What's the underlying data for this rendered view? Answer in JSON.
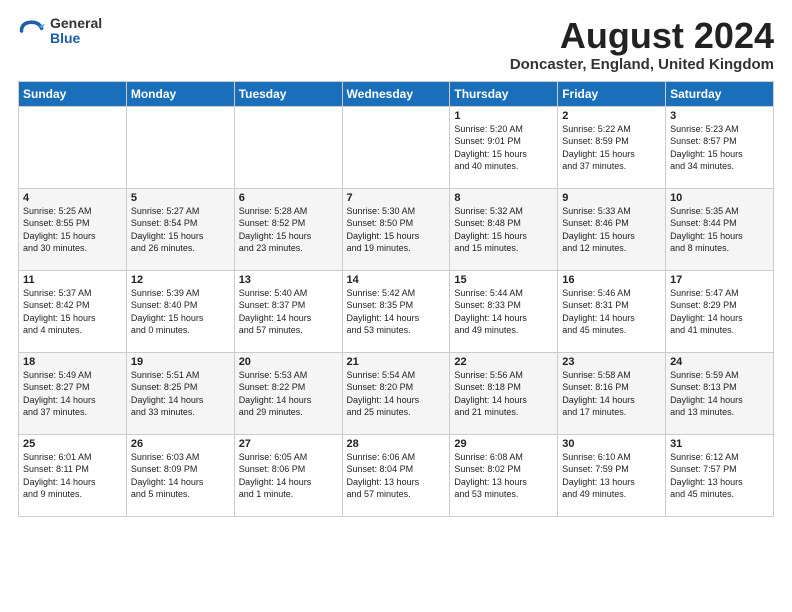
{
  "header": {
    "logo_general": "General",
    "logo_blue": "Blue",
    "month_title": "August 2024",
    "location": "Doncaster, England, United Kingdom"
  },
  "days_of_week": [
    "Sunday",
    "Monday",
    "Tuesday",
    "Wednesday",
    "Thursday",
    "Friday",
    "Saturday"
  ],
  "weeks": [
    [
      {
        "day": "",
        "info": ""
      },
      {
        "day": "",
        "info": ""
      },
      {
        "day": "",
        "info": ""
      },
      {
        "day": "",
        "info": ""
      },
      {
        "day": "1",
        "info": "Sunrise: 5:20 AM\nSunset: 9:01 PM\nDaylight: 15 hours\nand 40 minutes."
      },
      {
        "day": "2",
        "info": "Sunrise: 5:22 AM\nSunset: 8:59 PM\nDaylight: 15 hours\nand 37 minutes."
      },
      {
        "day": "3",
        "info": "Sunrise: 5:23 AM\nSunset: 8:57 PM\nDaylight: 15 hours\nand 34 minutes."
      }
    ],
    [
      {
        "day": "4",
        "info": "Sunrise: 5:25 AM\nSunset: 8:55 PM\nDaylight: 15 hours\nand 30 minutes."
      },
      {
        "day": "5",
        "info": "Sunrise: 5:27 AM\nSunset: 8:54 PM\nDaylight: 15 hours\nand 26 minutes."
      },
      {
        "day": "6",
        "info": "Sunrise: 5:28 AM\nSunset: 8:52 PM\nDaylight: 15 hours\nand 23 minutes."
      },
      {
        "day": "7",
        "info": "Sunrise: 5:30 AM\nSunset: 8:50 PM\nDaylight: 15 hours\nand 19 minutes."
      },
      {
        "day": "8",
        "info": "Sunrise: 5:32 AM\nSunset: 8:48 PM\nDaylight: 15 hours\nand 15 minutes."
      },
      {
        "day": "9",
        "info": "Sunrise: 5:33 AM\nSunset: 8:46 PM\nDaylight: 15 hours\nand 12 minutes."
      },
      {
        "day": "10",
        "info": "Sunrise: 5:35 AM\nSunset: 8:44 PM\nDaylight: 15 hours\nand 8 minutes."
      }
    ],
    [
      {
        "day": "11",
        "info": "Sunrise: 5:37 AM\nSunset: 8:42 PM\nDaylight: 15 hours\nand 4 minutes."
      },
      {
        "day": "12",
        "info": "Sunrise: 5:39 AM\nSunset: 8:40 PM\nDaylight: 15 hours\nand 0 minutes."
      },
      {
        "day": "13",
        "info": "Sunrise: 5:40 AM\nSunset: 8:37 PM\nDaylight: 14 hours\nand 57 minutes."
      },
      {
        "day": "14",
        "info": "Sunrise: 5:42 AM\nSunset: 8:35 PM\nDaylight: 14 hours\nand 53 minutes."
      },
      {
        "day": "15",
        "info": "Sunrise: 5:44 AM\nSunset: 8:33 PM\nDaylight: 14 hours\nand 49 minutes."
      },
      {
        "day": "16",
        "info": "Sunrise: 5:46 AM\nSunset: 8:31 PM\nDaylight: 14 hours\nand 45 minutes."
      },
      {
        "day": "17",
        "info": "Sunrise: 5:47 AM\nSunset: 8:29 PM\nDaylight: 14 hours\nand 41 minutes."
      }
    ],
    [
      {
        "day": "18",
        "info": "Sunrise: 5:49 AM\nSunset: 8:27 PM\nDaylight: 14 hours\nand 37 minutes."
      },
      {
        "day": "19",
        "info": "Sunrise: 5:51 AM\nSunset: 8:25 PM\nDaylight: 14 hours\nand 33 minutes."
      },
      {
        "day": "20",
        "info": "Sunrise: 5:53 AM\nSunset: 8:22 PM\nDaylight: 14 hours\nand 29 minutes."
      },
      {
        "day": "21",
        "info": "Sunrise: 5:54 AM\nSunset: 8:20 PM\nDaylight: 14 hours\nand 25 minutes."
      },
      {
        "day": "22",
        "info": "Sunrise: 5:56 AM\nSunset: 8:18 PM\nDaylight: 14 hours\nand 21 minutes."
      },
      {
        "day": "23",
        "info": "Sunrise: 5:58 AM\nSunset: 8:16 PM\nDaylight: 14 hours\nand 17 minutes."
      },
      {
        "day": "24",
        "info": "Sunrise: 5:59 AM\nSunset: 8:13 PM\nDaylight: 14 hours\nand 13 minutes."
      }
    ],
    [
      {
        "day": "25",
        "info": "Sunrise: 6:01 AM\nSunset: 8:11 PM\nDaylight: 14 hours\nand 9 minutes."
      },
      {
        "day": "26",
        "info": "Sunrise: 6:03 AM\nSunset: 8:09 PM\nDaylight: 14 hours\nand 5 minutes."
      },
      {
        "day": "27",
        "info": "Sunrise: 6:05 AM\nSunset: 8:06 PM\nDaylight: 14 hours\nand 1 minute."
      },
      {
        "day": "28",
        "info": "Sunrise: 6:06 AM\nSunset: 8:04 PM\nDaylight: 13 hours\nand 57 minutes."
      },
      {
        "day": "29",
        "info": "Sunrise: 6:08 AM\nSunset: 8:02 PM\nDaylight: 13 hours\nand 53 minutes."
      },
      {
        "day": "30",
        "info": "Sunrise: 6:10 AM\nSunset: 7:59 PM\nDaylight: 13 hours\nand 49 minutes."
      },
      {
        "day": "31",
        "info": "Sunrise: 6:12 AM\nSunset: 7:57 PM\nDaylight: 13 hours\nand 45 minutes."
      }
    ]
  ]
}
